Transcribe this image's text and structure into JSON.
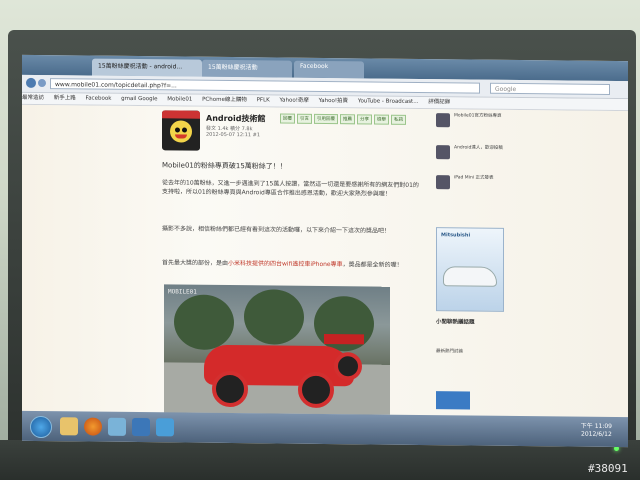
{
  "photo": {
    "id_label": "#38091"
  },
  "browser": {
    "tabs": [
      "15萬粉絲慶祝活動 - android...",
      "15萬粉絲慶祝活動",
      "Facebook"
    ],
    "url": "www.mobile01.com/topicdetail.php?f=...",
    "search_placeholder": "Google",
    "bookmarks": [
      "最常造訪",
      "新手上路",
      "Facebook",
      "gmail Google",
      "Mobile01",
      "PChome線上購物",
      "PFLK",
      "Yahoo!奇摩",
      "Yahoo!拍賣",
      "YouTube - Broadcast...",
      "評價記錄"
    ]
  },
  "post": {
    "author": "Android技術館",
    "meta": "發文 1.4k  積分 7.8k",
    "date": "2012-05-07 12:11 #1",
    "actions": [
      "回覆",
      "引言",
      "引用回覆",
      "推薦",
      "分享",
      "檢舉",
      "私訊"
    ],
    "headline": "Mobile01的粉絲專頁破15萬粉絲了！！",
    "para1": "從去年的10萬粉絲，又進一步邁進到了15萬人按讚，當然這一切還是要感謝所有的網友們對01的支持啦，所以01的粉絲專頁與Android專區合作推出感恩活動，歡迎大家熱烈參與喔！",
    "para2": "攝影不多說，相信粉絲們都已經有看到這次的活動囉，以下來介紹一下這次的獎品吧！",
    "para3_lead": "首先最大獎的部份，是由",
    "para3_red": "小米科技提供的四台wifi遙控車iPhone專車",
    "para3_tail": "，獎品都是全新的喔！",
    "image_label": "MOBILE01"
  },
  "sidebar": {
    "block1": "Mobile01官方粉絲專頁",
    "block2": "Android達人，歡迎投稿",
    "block3": "iPad Mini 正式發表",
    "ad_title": "Mitsubishi",
    "heading": "小閒聊熱議話題",
    "block4": "最新熱門討論"
  },
  "taskbar": {
    "time": "下午 11:09",
    "date": "2012/6/12"
  }
}
